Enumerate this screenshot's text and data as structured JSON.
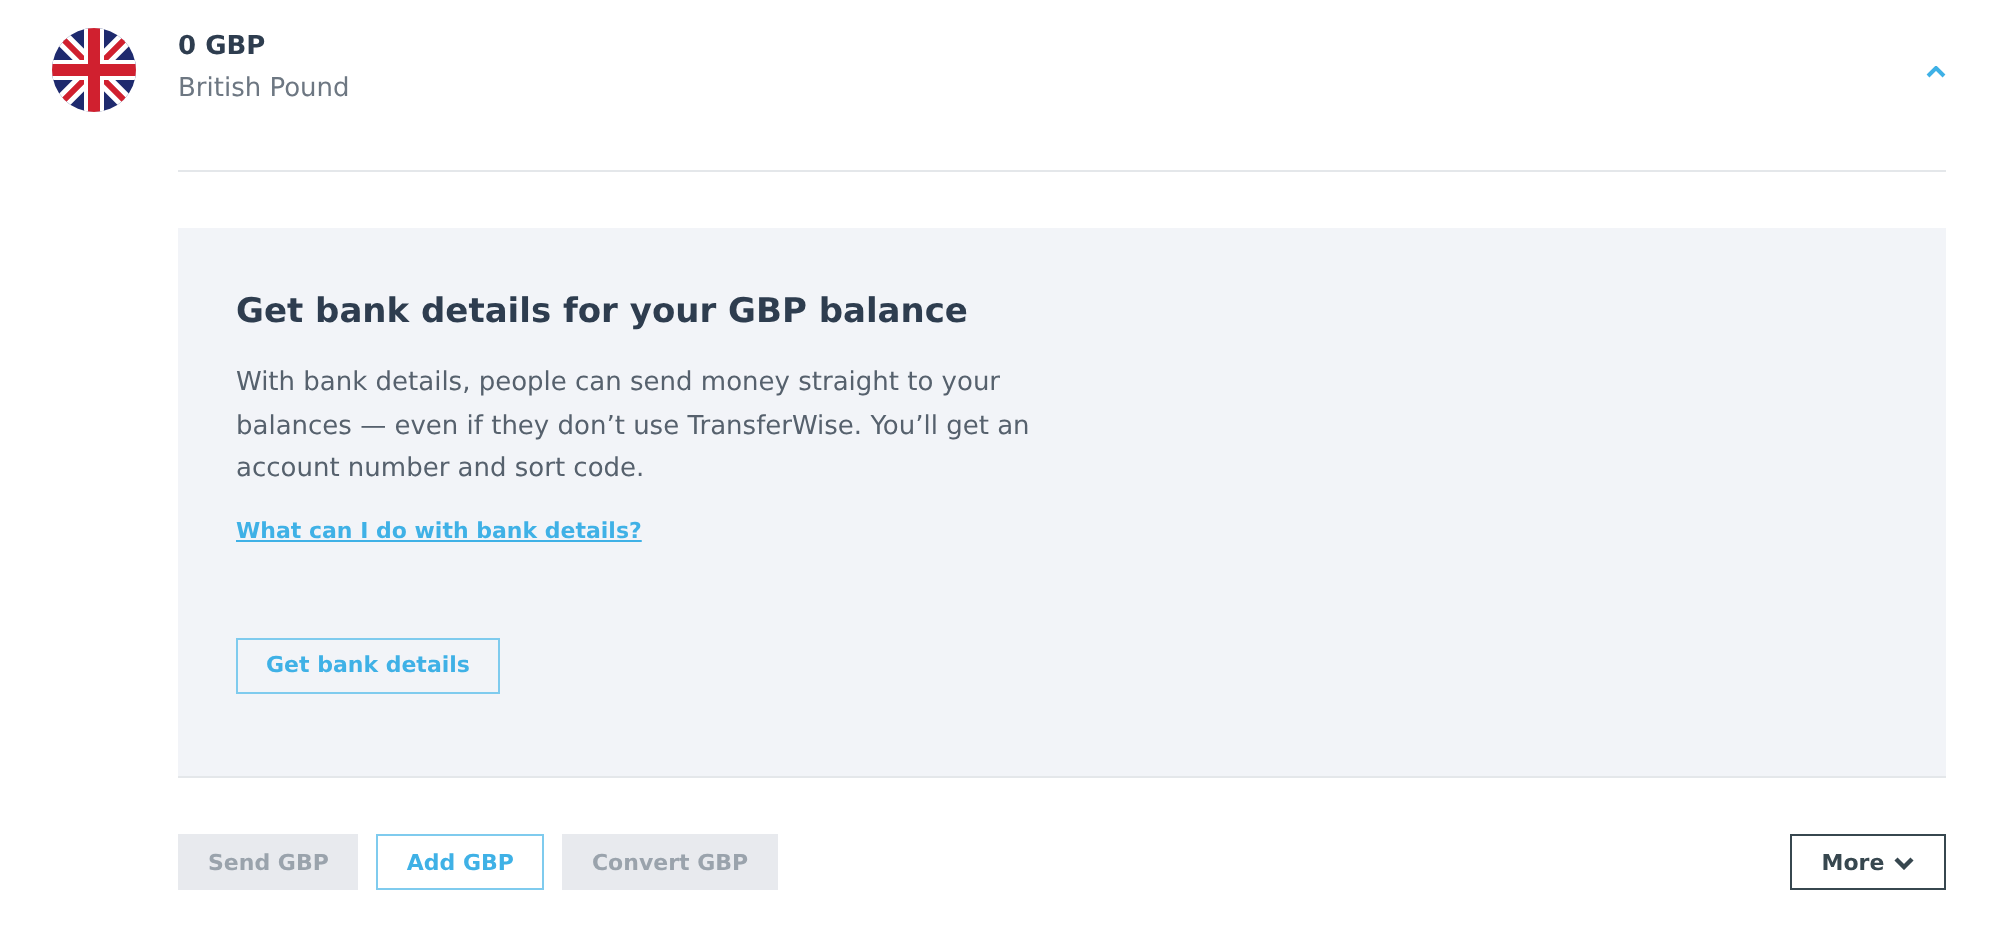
{
  "balance": {
    "amount": "0 GBP",
    "currency_name": "British Pound",
    "expanded": true
  },
  "bank_details_panel": {
    "title": "Get bank details for your GBP balance",
    "text": "With bank details, people can send money straight to your balances — even if they don’t use TransferWise. You’ll get an account number and sort code.",
    "link": "What can I do with bank details?",
    "button": "Get bank details"
  },
  "actions": [
    {
      "label": "Send GBP",
      "disabled": true
    },
    {
      "label": "Add GBP",
      "disabled": false
    },
    {
      "label": "Convert GBP",
      "disabled": true
    }
  ],
  "more_button": {
    "label": "More"
  }
}
